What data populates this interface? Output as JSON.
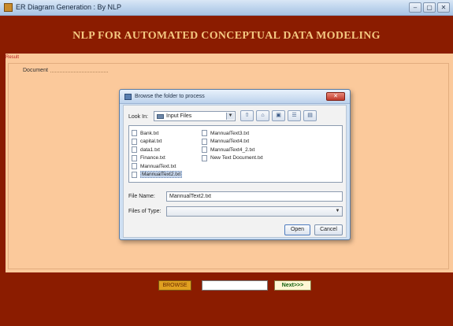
{
  "window": {
    "title": "ER Diagram Generation : By NLP",
    "controls": [
      "–",
      "▢",
      "✕"
    ]
  },
  "banner": {
    "heading": "NLP FOR AUTOMATED CONCEPTUAL DATA MODELING"
  },
  "result": {
    "label": "Result",
    "document_label": "Document"
  },
  "bottom": {
    "browse_label": "BROWSE",
    "path_value": "",
    "next_label": "Next>>>"
  },
  "dialog": {
    "title": "Browse the folder to process",
    "look_in_label": "Look In:",
    "look_in_value": "Input Files",
    "files_col1": [
      "Bank.txt",
      "capital.txt",
      "data1.txt",
      "Finance.txt",
      "MannualText.txt",
      "MannualText2.txt"
    ],
    "files_col2": [
      "MannualText3.txt",
      "MannualText4.txt",
      "MannualText4_2.txt",
      "New Text Document.txt"
    ],
    "selected_file": "MannualText2.txt",
    "file_name_label": "File Name:",
    "file_name_value": "MannualText2.txt",
    "file_type_label": "Files of Type:",
    "file_type_value": "",
    "open_label": "Open",
    "cancel_label": "Cancel"
  },
  "colors": {
    "banner": "#8b1c00",
    "panel": "#fbc99b",
    "heading": "#f4c882",
    "browse": "#e0a020"
  }
}
